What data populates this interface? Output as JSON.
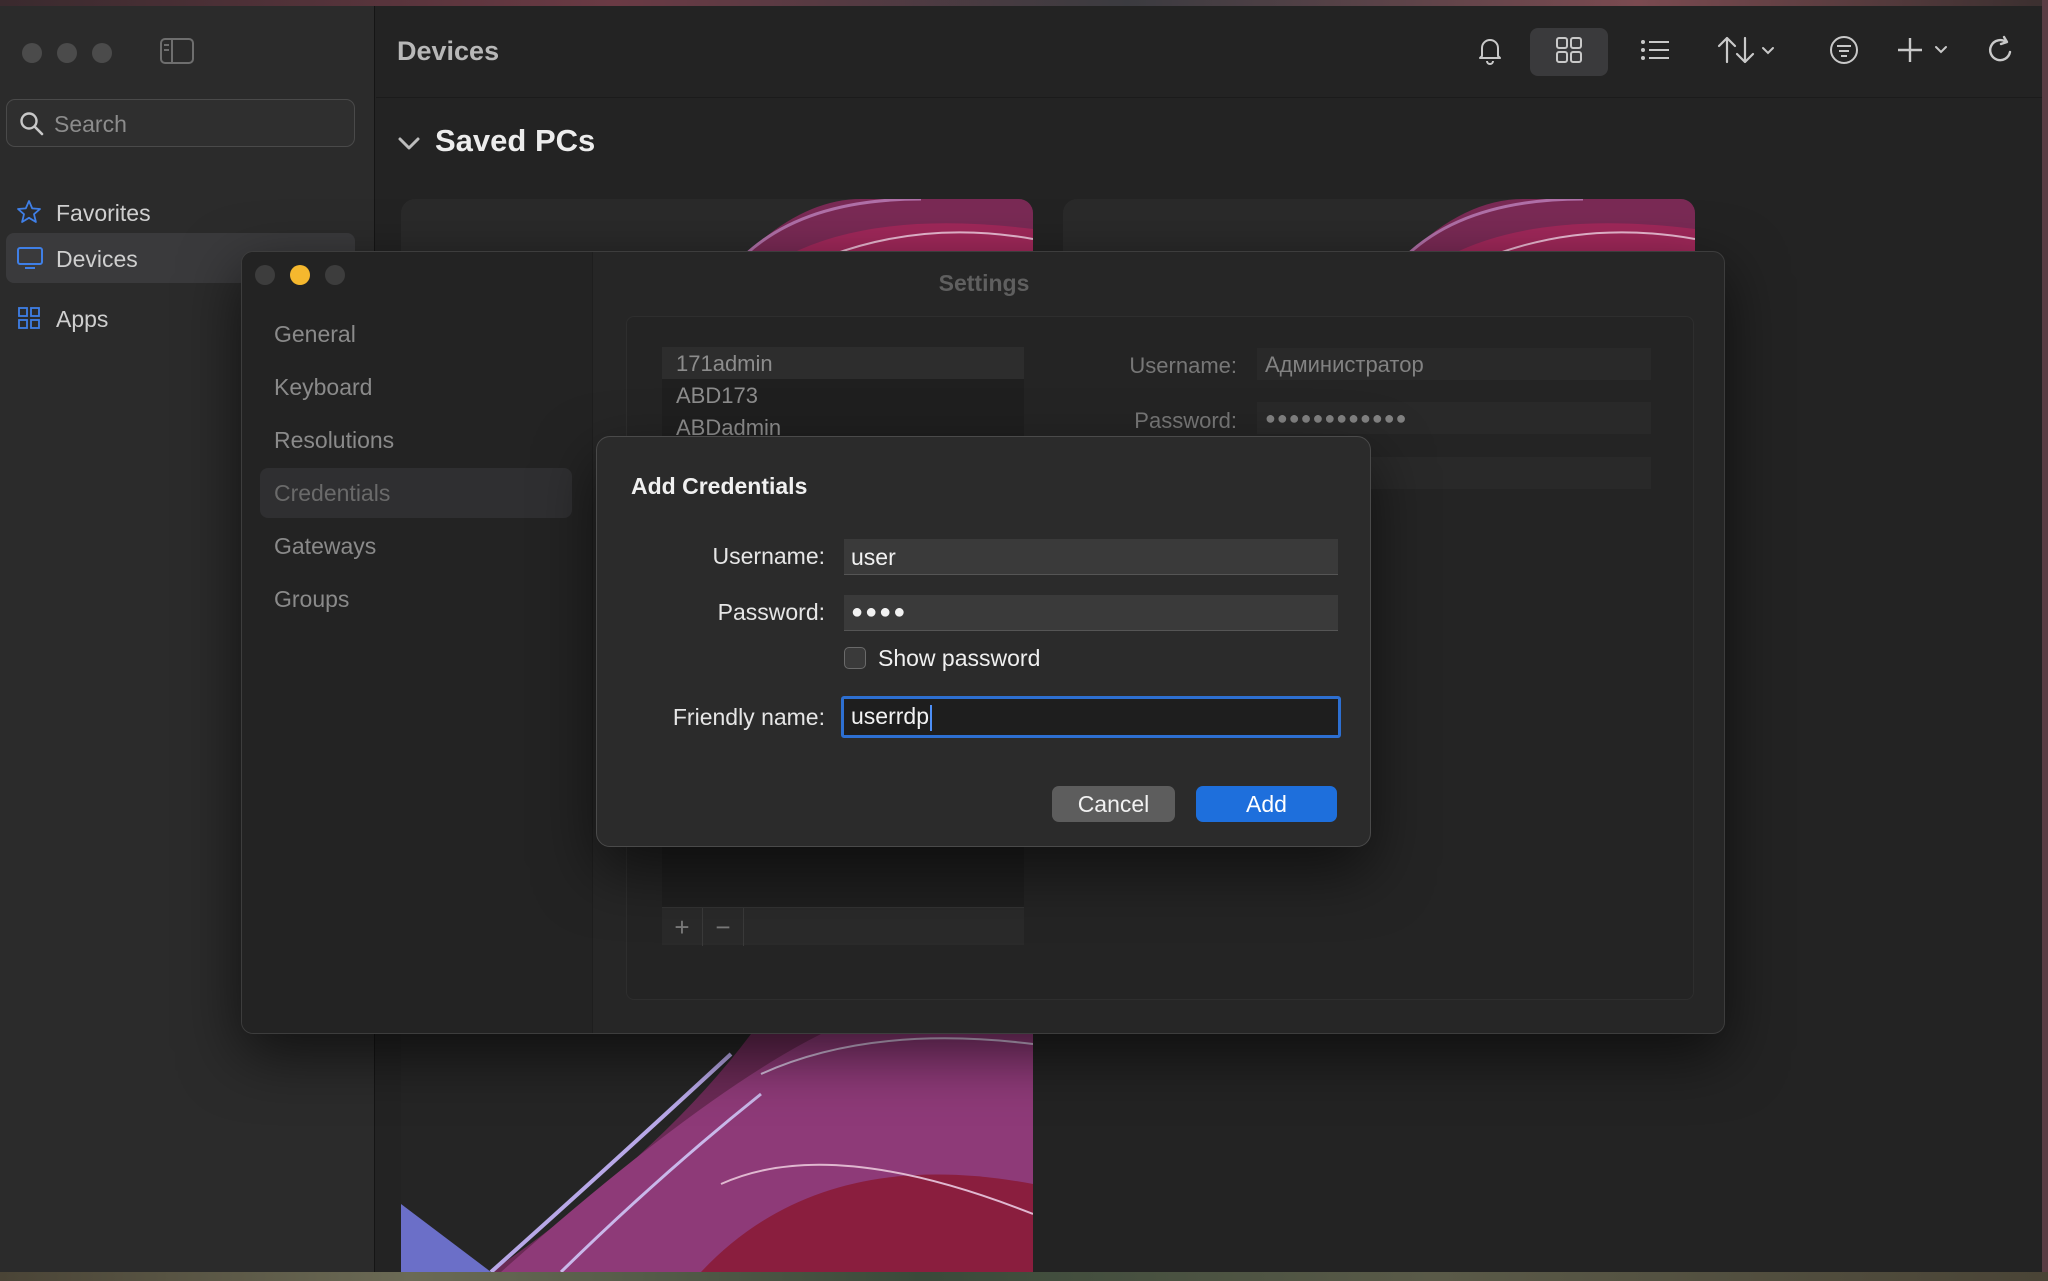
{
  "window": {
    "title": "Devices"
  },
  "sidebar": {
    "search_placeholder": "Search",
    "items": [
      {
        "label": "Favorites",
        "icon": "star-icon"
      },
      {
        "label": "Devices",
        "icon": "monitor-icon"
      },
      {
        "label": "Apps",
        "icon": "grid-icon"
      }
    ],
    "selected": "Devices"
  },
  "toolbar": {
    "buttons": [
      "bell-icon",
      "grid-view-icon",
      "list-view-icon",
      "sort-icon",
      "filter-icon",
      "plus-icon",
      "refresh-icon"
    ]
  },
  "main": {
    "section_title": "Saved PCs"
  },
  "settings": {
    "title": "Settings",
    "nav": [
      "General",
      "Keyboard",
      "Resolutions",
      "Credentials",
      "Gateways",
      "Groups"
    ],
    "selected_nav": "Credentials",
    "credentials_list": [
      "171admin",
      "ABD173",
      "ABDadmin"
    ],
    "detail": {
      "username_label": "Username:",
      "username_value": "Администратор",
      "password_label": "Password:",
      "password_value": "●●●●●●●●●●●●"
    },
    "list_buttons": [
      "+",
      "−"
    ]
  },
  "dialog": {
    "title": "Add Credentials",
    "username_label": "Username:",
    "username_value": "user",
    "password_label": "Password:",
    "password_value": "●●●●",
    "show_password_label": "Show password",
    "show_password_checked": false,
    "friendly_name_label": "Friendly name:",
    "friendly_name_value": "userrdp",
    "cancel_label": "Cancel",
    "add_label": "Add"
  },
  "colors": {
    "accent": "#1e6fdc",
    "focus_ring": "#2d6fd1",
    "minimize_yellow": "#f5b82e"
  }
}
